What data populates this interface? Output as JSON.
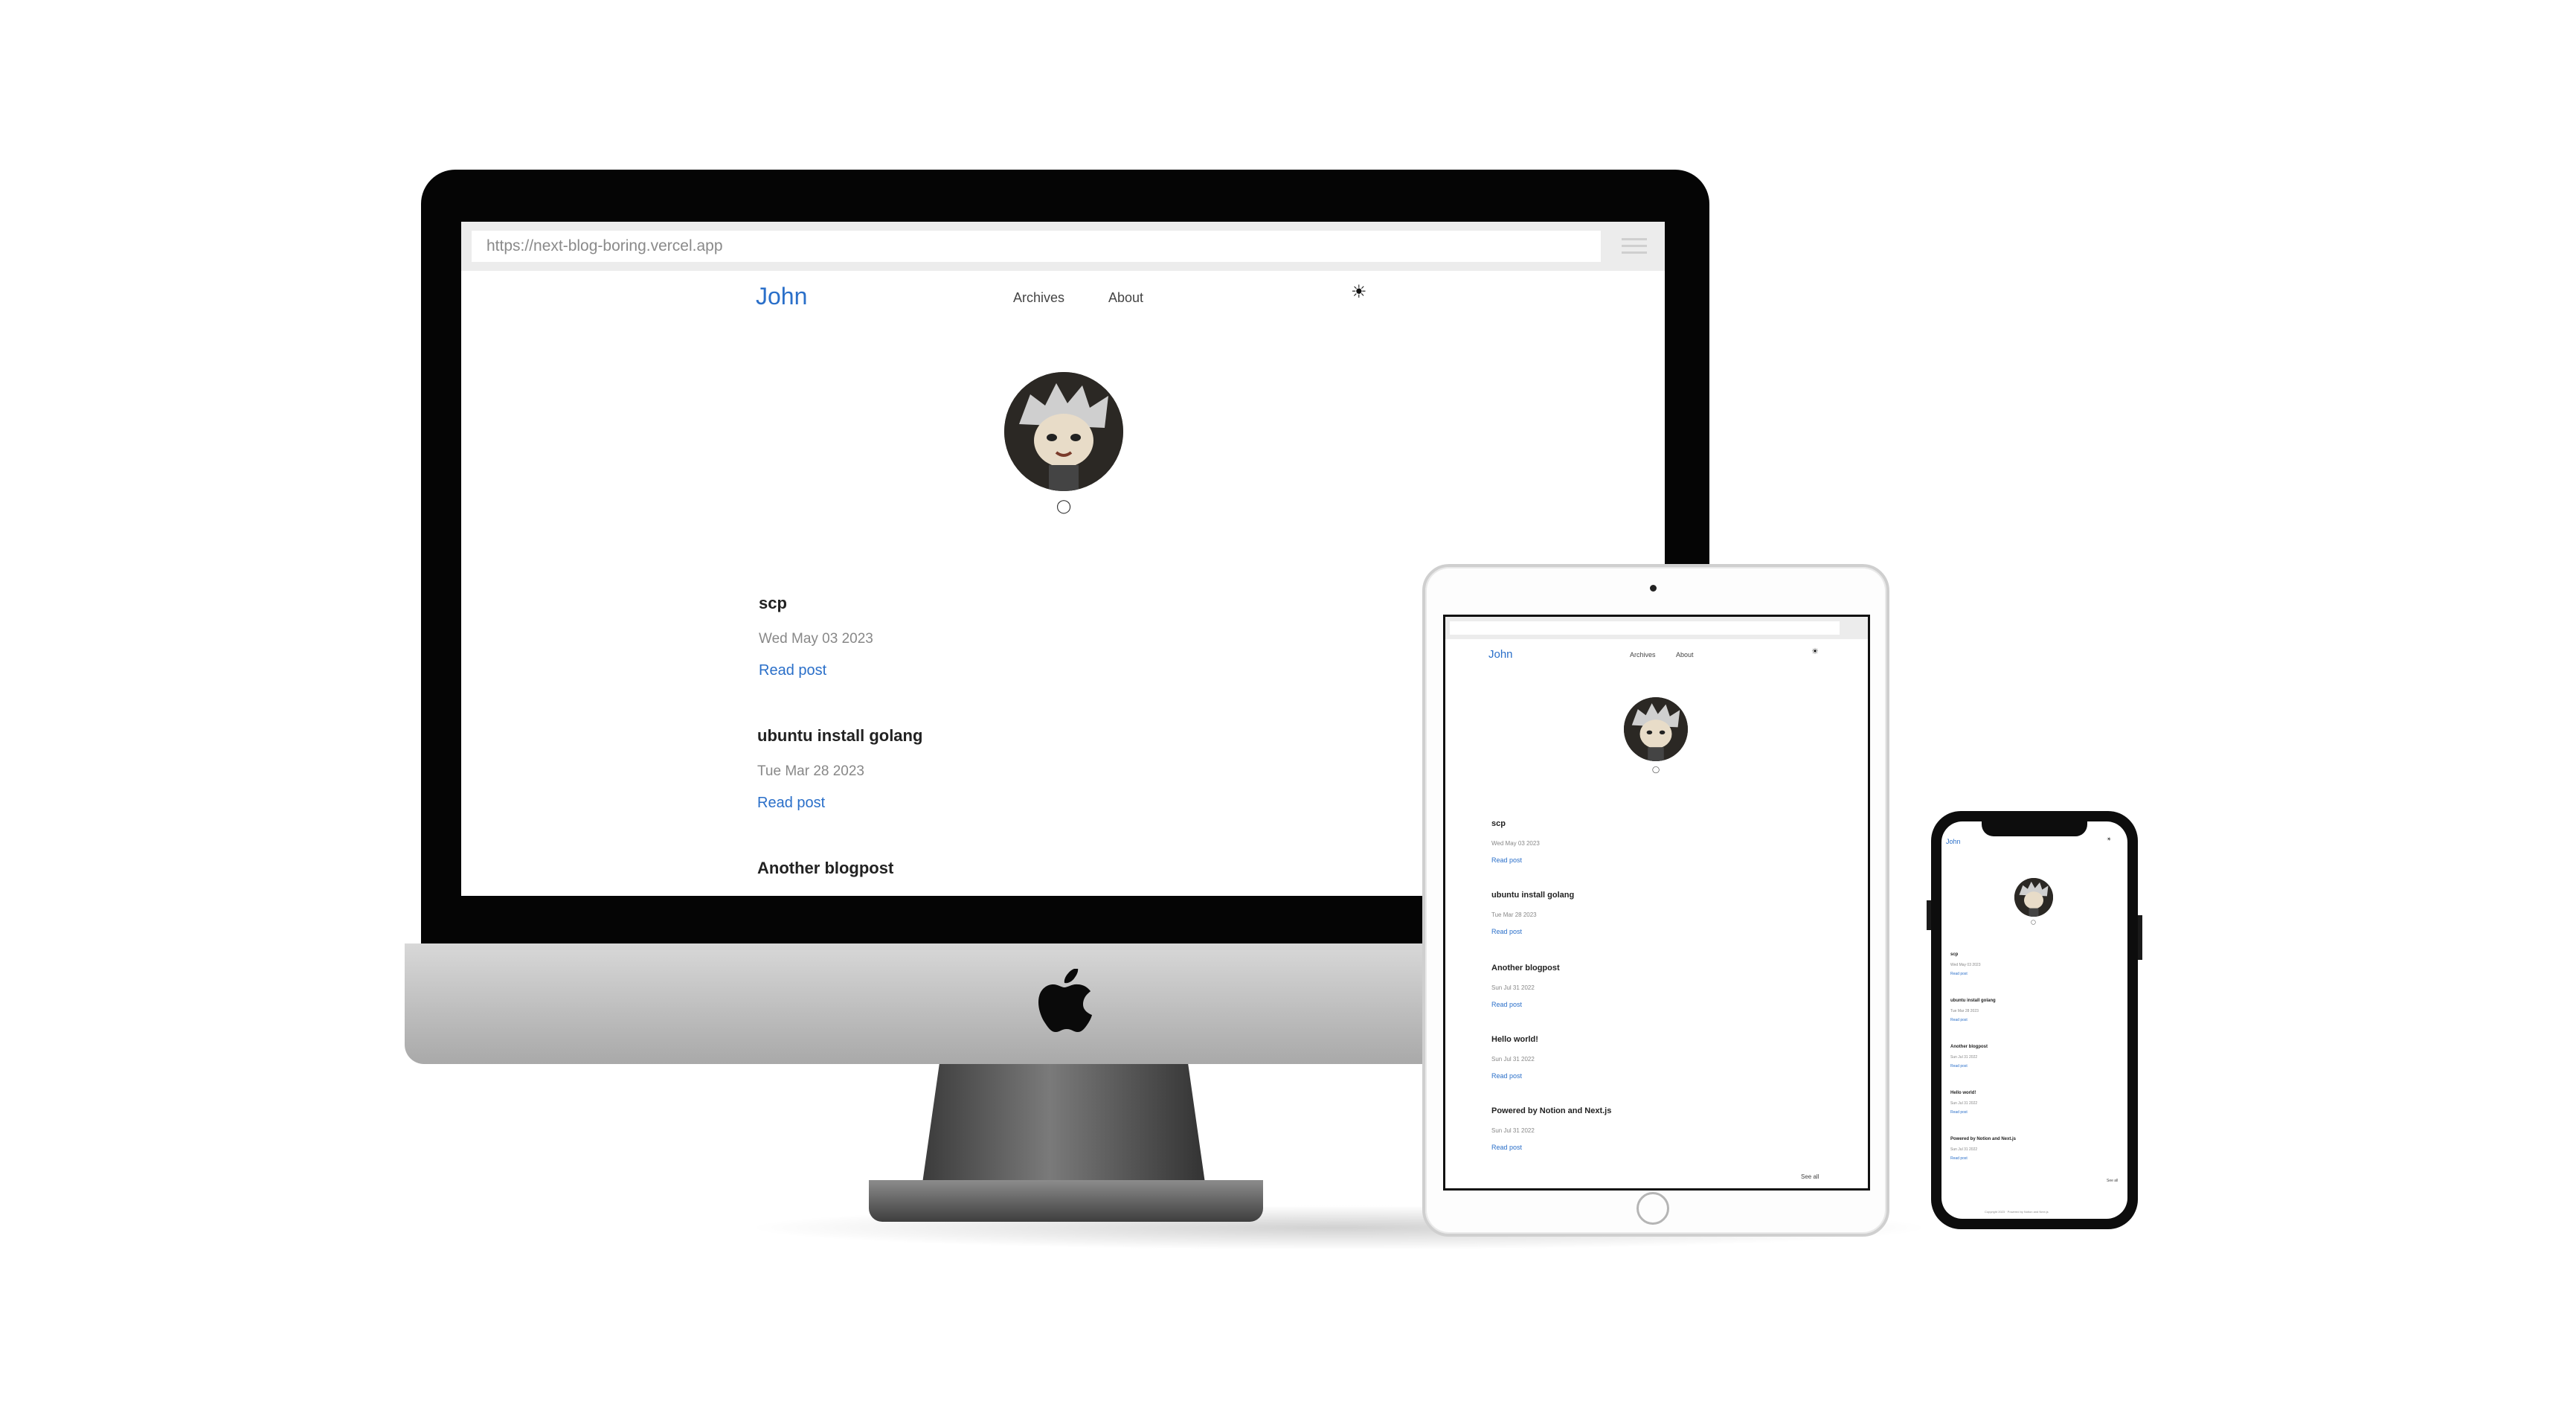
{
  "browser": {
    "url": "https://next-blog-boring.vercel.app"
  },
  "site": {
    "title": "John",
    "nav": [
      {
        "label": "Archives"
      },
      {
        "label": "About"
      }
    ],
    "theme_icon": "sun-icon",
    "social_icon": "github-icon",
    "read_label": "Read post",
    "see_all_label": "See all",
    "footer_text": "Copyright 2023 · Powered by Notion and Next.js"
  },
  "posts": [
    {
      "title": "scp",
      "date": "Wed May 03 2023"
    },
    {
      "title": "ubuntu install golang",
      "date": "Tue Mar 28 2023"
    },
    {
      "title": "Another blogpost",
      "date": "Sun Jul 31 2022"
    },
    {
      "title": "Hello world!",
      "date": "Sun Jul 31 2022"
    },
    {
      "title": "Powered by Notion and Next.js",
      "date": "Sun Jul 31 2022"
    }
  ],
  "colors": {
    "accent": "#2a6fc9",
    "text": "#222222",
    "muted": "#888888"
  }
}
